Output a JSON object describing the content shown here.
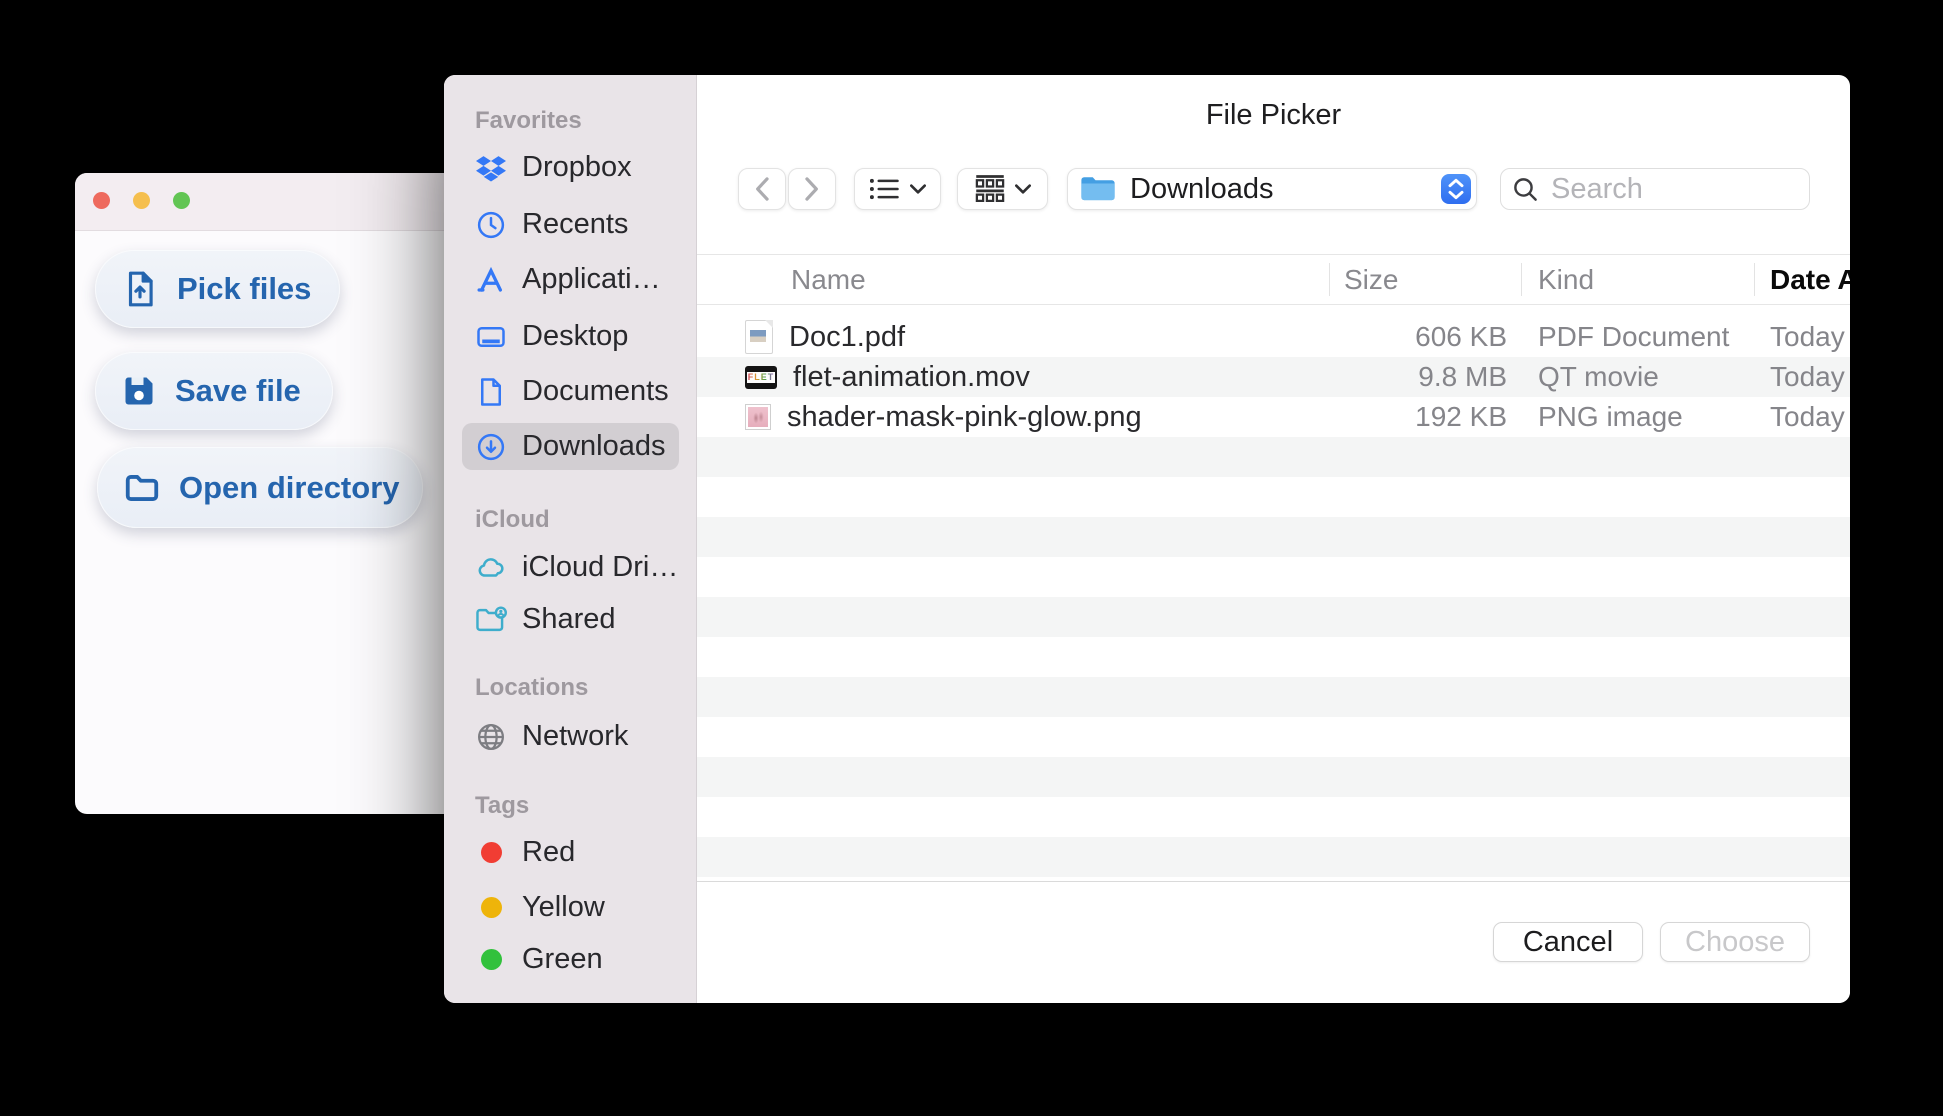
{
  "app": {
    "buttons": [
      {
        "label": "Pick files"
      },
      {
        "label": "Save file"
      },
      {
        "label": "Open directory"
      }
    ]
  },
  "dialog": {
    "title": "File Picker",
    "sidebar": {
      "sections": [
        {
          "label": "Favorites",
          "items": [
            {
              "label": "Dropbox"
            },
            {
              "label": "Recents"
            },
            {
              "label": "Applicati…"
            },
            {
              "label": "Desktop"
            },
            {
              "label": "Documents"
            },
            {
              "label": "Downloads",
              "selected": true
            }
          ]
        },
        {
          "label": "iCloud",
          "items": [
            {
              "label": "iCloud Dri…"
            },
            {
              "label": "Shared"
            }
          ]
        },
        {
          "label": "Locations",
          "items": [
            {
              "label": "Network"
            }
          ]
        },
        {
          "label": "Tags",
          "items": [
            {
              "label": "Red",
              "color": "#f13d33"
            },
            {
              "label": "Yellow",
              "color": "#eeb40a"
            },
            {
              "label": "Green",
              "color": "#32c13c"
            }
          ]
        }
      ]
    },
    "toolbar": {
      "location": "Downloads",
      "search_placeholder": "Search"
    },
    "table": {
      "columns": [
        "Name",
        "Size",
        "Kind",
        "Date Added"
      ],
      "files": [
        {
          "name": "Doc1.pdf",
          "size": "606 KB",
          "kind": "PDF Document",
          "date": "Today"
        },
        {
          "name": "flet-animation.mov",
          "size": "9.8 MB",
          "kind": "QT movie",
          "date": "Today",
          "thumbnail_text": "FLET"
        },
        {
          "name": "shader-mask-pink-glow.png",
          "size": "192 KB",
          "kind": "PNG image",
          "date": "Today"
        }
      ]
    },
    "footer": {
      "cancel": "Cancel",
      "choose": "Choose"
    },
    "colors": {
      "accent_blue": "#3478f6",
      "sidebar_bg": "#e9e4e8",
      "selected_item_bg": "#d2ced2",
      "row_stripe": "#f4f5f5",
      "tag_red": "#f13d33",
      "tag_yellow": "#eeb40a",
      "tag_green": "#32c13c"
    }
  }
}
